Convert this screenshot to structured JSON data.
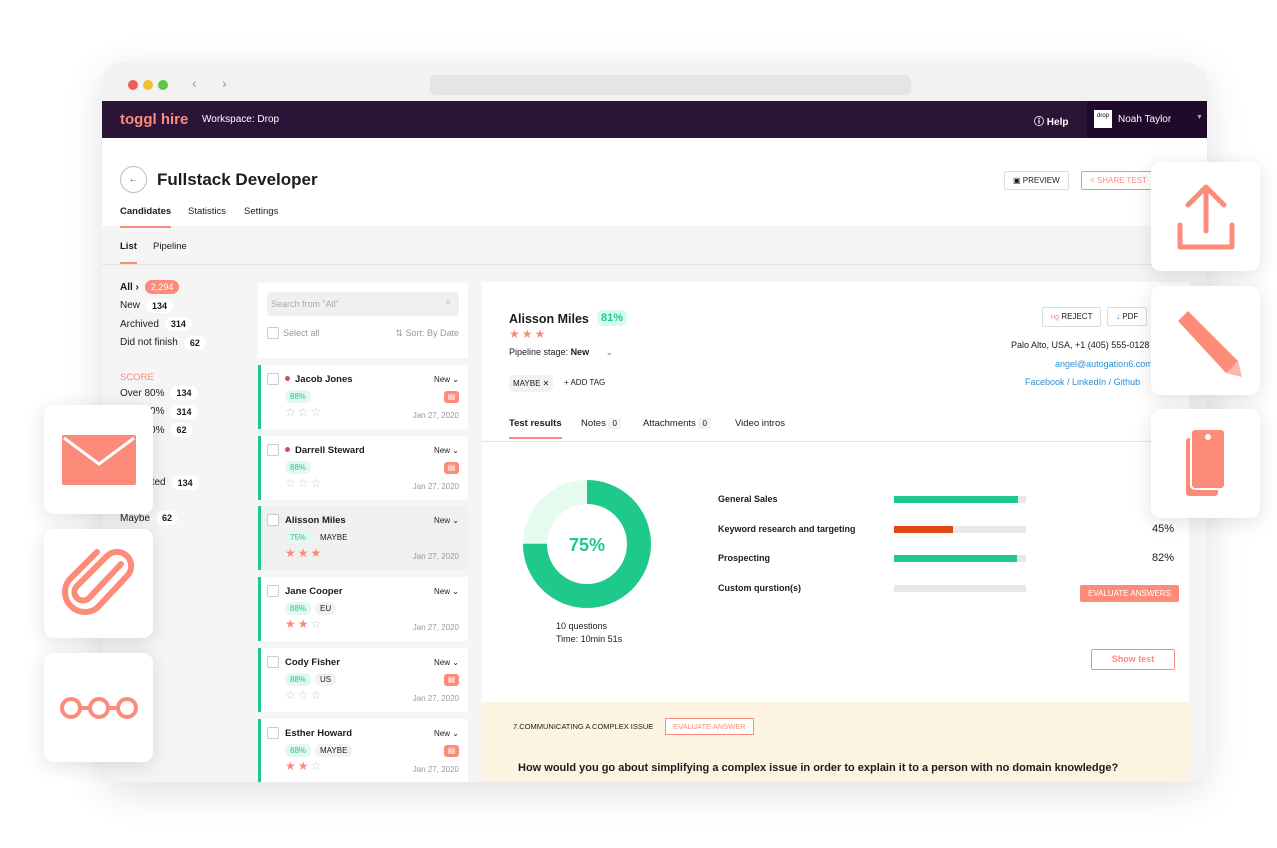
{
  "nav": {
    "logo": "toggl hire",
    "workspace": "Workspace: Drop",
    "help": "Help",
    "user": "Noah Taylor",
    "avatar_text": "drop"
  },
  "header": {
    "title": "Fullstack Developer",
    "tabs": [
      "Candidates",
      "Statistics",
      "Settings"
    ],
    "preview": "PREVIEW",
    "share": "SHARE TEST"
  },
  "subtabs": [
    "List",
    "Pipeline"
  ],
  "filters": {
    "status": [
      {
        "label": "All ›",
        "count": "2,294"
      },
      {
        "label": "New",
        "count": "134"
      },
      {
        "label": "Archived",
        "count": "314"
      },
      {
        "label": "Did not finish",
        "count": "62"
      }
    ],
    "score_title": "SCORE",
    "score": [
      {
        "label": "Over 80%",
        "count": "134"
      },
      {
        "label": "Over 60%",
        "count": "314"
      },
      {
        "label": "Over 40%",
        "count": "62"
      }
    ],
    "tags": [
      {
        "label": "Contacted",
        "count": "134"
      },
      {
        "label": "Maybe",
        "count": "62"
      }
    ]
  },
  "list": {
    "search_placeholder": "Search from \"All\"",
    "select_all": "Select all",
    "sort": "Sort: By Date",
    "candidates": [
      {
        "name": "Jacob Jones",
        "unread": true,
        "score": "88%",
        "tag": "",
        "stage": "New",
        "stars": 0,
        "date": "Jan 27, 2020",
        "doc": true
      },
      {
        "name": "Darrell Steward",
        "unread": true,
        "score": "88%",
        "tag": "",
        "stage": "New",
        "stars": 0,
        "date": "Jan 27, 2020",
        "doc": true
      },
      {
        "name": "Alisson Miles",
        "unread": false,
        "score": "75%",
        "tag": "MAYBE",
        "stage": "New",
        "stars": 3,
        "date": "Jan 27, 2020",
        "doc": false,
        "selected": true
      },
      {
        "name": "Jane Cooper",
        "unread": false,
        "score": "88%",
        "tag": "EU",
        "stage": "New",
        "stars": 2,
        "date": "Jan 27, 2020",
        "doc": false
      },
      {
        "name": "Cody Fisher",
        "unread": false,
        "score": "88%",
        "tag": "US",
        "stage": "New",
        "stars": 0,
        "date": "Jan 27, 2020",
        "doc": true
      },
      {
        "name": "Esther Howard",
        "unread": false,
        "score": "88%",
        "tag": "MAYBE",
        "stage": "New",
        "stars": 2,
        "date": "Jan 27, 2020",
        "doc": true
      }
    ]
  },
  "detail": {
    "name": "Alisson Miles",
    "score": "81%",
    "stars": 3,
    "pipeline_label": "Pipeline stage:",
    "pipeline_value": "New",
    "reject": "REJECT",
    "pdf": "PDF",
    "location": "Palo Alto, USA, +1 (405) 555-0128",
    "email": "angel@autogation6.com",
    "links": [
      "Facebook",
      "LinkedIn",
      "Github"
    ],
    "tag": "MAYBE",
    "add_tag": "+ ADD TAG",
    "tabs": [
      {
        "label": "Test results",
        "count": ""
      },
      {
        "label": "Notes",
        "count": "0"
      },
      {
        "label": "Attachments",
        "count": "0"
      },
      {
        "label": "Video intros",
        "count": ""
      }
    ],
    "donut": {
      "value": 75,
      "label": "75%"
    },
    "questions": "10 questions",
    "time": "Time: 10min 51s",
    "skills": [
      {
        "name": "General Sales",
        "value": 94,
        "pct": "",
        "color": "#1ec98b"
      },
      {
        "name": "Keyword research and targeting",
        "value": 45,
        "pct": "45%",
        "color": "#e04a12"
      },
      {
        "name": "Prospecting",
        "value": 93,
        "pct": "82%",
        "color": "#1ec98b"
      },
      {
        "name": "Custom qurstion(s)",
        "value": 0,
        "pct": "",
        "color": "#1ec98b"
      }
    ],
    "evaluate_answers": "EVALUATE ANSWERS",
    "show_test": "Show test",
    "question_title": "7.COMMUNICATING A COMPLEX ISSUE",
    "evaluate_answer": "EVALUATE ANSWER",
    "question": "How would you go about simplifying a complex issue in order to explain it to a person with no domain knowledge?"
  },
  "colors": {
    "accent": "#fd8b7a",
    "nav": "#2c1338",
    "green": "#1ec98b"
  }
}
